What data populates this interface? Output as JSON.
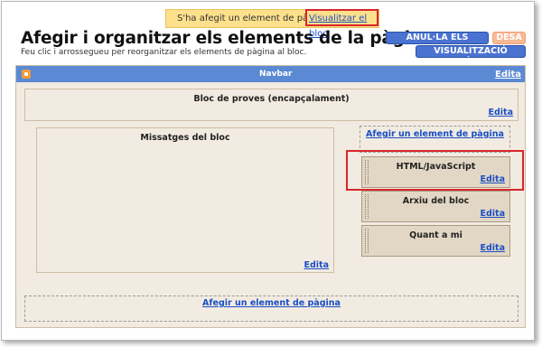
{
  "notice": {
    "message": "S'ha afegit un element de pàgina.",
    "view_link": "Visualitzar el bloc"
  },
  "header": {
    "title": "Afegir i organitzar els elements de la pàgina",
    "subtitle": "Feu clic i arrossegueu per reorganitzar els elements de pàgina al bloc."
  },
  "buttons": {
    "clear_edits": "ANUL·LA ELS CANVIS",
    "save": "DESA",
    "preview": "VISUALITZACIÓ PRÈVIA"
  },
  "navbar": {
    "label": "Navbar",
    "edit": "Edita"
  },
  "header_block": {
    "title": "Bloc de proves (encapçalament)",
    "edit": "Edita"
  },
  "main_block": {
    "title": "Missatges del bloc",
    "edit": "Edita"
  },
  "sidebar": {
    "add_element": "Afegir un element de pàgina",
    "gadgets": [
      {
        "title": "HTML/JavaScript",
        "edit": "Edita"
      },
      {
        "title": "Arxiu del bloc",
        "edit": "Edita"
      },
      {
        "title": "Quant a mi",
        "edit": "Edita"
      }
    ]
  },
  "footer": {
    "add_element": "Afegir un element de pàgina"
  },
  "colors": {
    "canvas_bg": "#f2ebe1",
    "navbar_bg": "#5b89d3",
    "gadget_bg": "#e2d7c4",
    "link": "#1a4fc6",
    "highlight": "#d9262b",
    "notice_bg": "#fde08c"
  }
}
